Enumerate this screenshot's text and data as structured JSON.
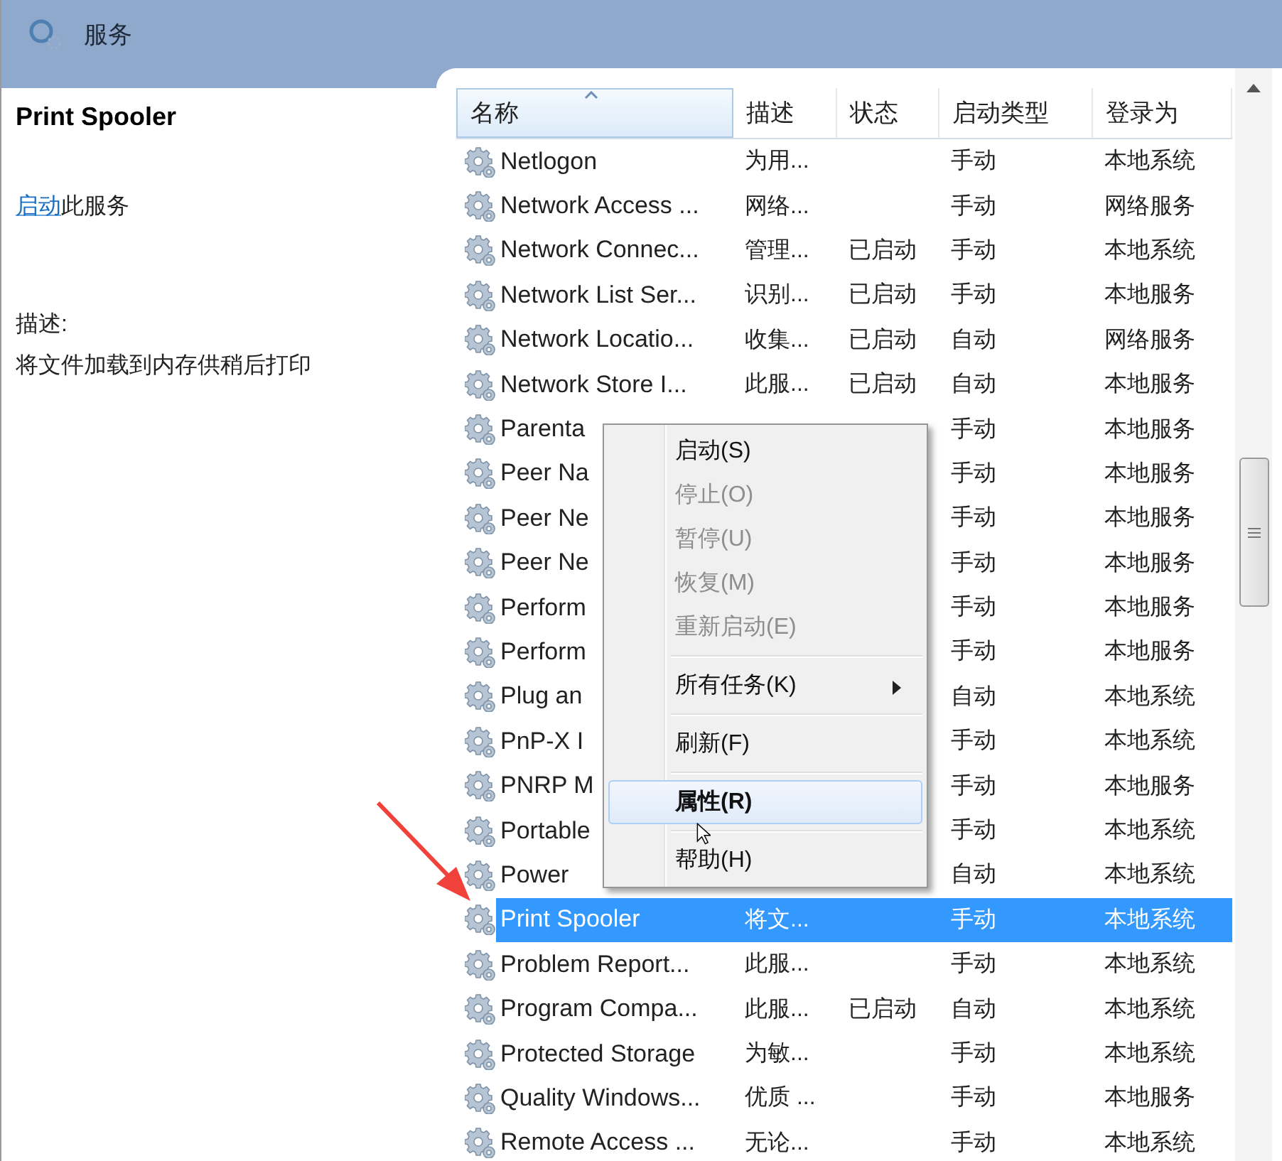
{
  "window": {
    "title": "服务"
  },
  "detail": {
    "title": "Print Spooler",
    "action_link": "启动",
    "action_text": "此服务",
    "description_label": "描述:",
    "description": "将文件加载到内存供稍后打印"
  },
  "table": {
    "columns": [
      {
        "label": "名称",
        "sorted": true
      },
      {
        "label": "描述",
        "sorted": false
      },
      {
        "label": "状态",
        "sorted": false
      },
      {
        "label": "启动类型",
        "sorted": false
      },
      {
        "label": "登录为",
        "sorted": false
      }
    ],
    "rows": [
      {
        "name": "Netlogon",
        "description": "为用...",
        "status": "",
        "startup": "手动",
        "logon": "本地系统",
        "selected": false
      },
      {
        "name": "Network Access ...",
        "description": "网络...",
        "status": "",
        "startup": "手动",
        "logon": "网络服务",
        "selected": false
      },
      {
        "name": "Network Connec...",
        "description": "管理...",
        "status": "已启动",
        "startup": "手动",
        "logon": "本地系统",
        "selected": false
      },
      {
        "name": "Network List Ser...",
        "description": "识别...",
        "status": "已启动",
        "startup": "手动",
        "logon": "本地服务",
        "selected": false
      },
      {
        "name": "Network Locatio...",
        "description": "收集...",
        "status": "已启动",
        "startup": "自动",
        "logon": "网络服务",
        "selected": false
      },
      {
        "name": "Network Store I...",
        "description": "此服...",
        "status": "已启动",
        "startup": "自动",
        "logon": "本地服务",
        "selected": false
      },
      {
        "name": "Parenta",
        "description": "",
        "status": "",
        "startup": "手动",
        "logon": "本地服务",
        "selected": false
      },
      {
        "name": "Peer Na",
        "description": "",
        "status": "",
        "startup": "手动",
        "logon": "本地服务",
        "selected": false
      },
      {
        "name": "Peer Ne",
        "description": "",
        "status": "",
        "startup": "手动",
        "logon": "本地服务",
        "selected": false
      },
      {
        "name": "Peer Ne",
        "description": "",
        "status": "",
        "startup": "手动",
        "logon": "本地服务",
        "selected": false
      },
      {
        "name": "Perform",
        "description": "",
        "status": "",
        "startup": "手动",
        "logon": "本地服务",
        "selected": false
      },
      {
        "name": "Perform",
        "description": "",
        "status": "",
        "startup": "手动",
        "logon": "本地服务",
        "selected": false
      },
      {
        "name": "Plug an",
        "description": "",
        "status": "",
        "startup": "自动",
        "logon": "本地系统",
        "selected": false
      },
      {
        "name": "PnP-X I",
        "description": "",
        "status": "",
        "startup": "手动",
        "logon": "本地系统",
        "selected": false
      },
      {
        "name": "PNRP M",
        "description": "",
        "status": "",
        "startup": "手动",
        "logon": "本地服务",
        "selected": false
      },
      {
        "name": "Portable",
        "description": "",
        "status": "",
        "startup": "手动",
        "logon": "本地系统",
        "selected": false
      },
      {
        "name": "Power",
        "description": "",
        "status": "",
        "startup": "自动",
        "logon": "本地系统",
        "selected": false
      },
      {
        "name": "Print Spooler",
        "description": "将文...",
        "status": "",
        "startup": "手动",
        "logon": "本地系统",
        "selected": true
      },
      {
        "name": "Problem Report...",
        "description": "此服...",
        "status": "",
        "startup": "手动",
        "logon": "本地系统",
        "selected": false
      },
      {
        "name": "Program Compa...",
        "description": "此服...",
        "status": "已启动",
        "startup": "自动",
        "logon": "本地系统",
        "selected": false
      },
      {
        "name": "Protected Storage",
        "description": "为敏...",
        "status": "",
        "startup": "手动",
        "logon": "本地系统",
        "selected": false
      },
      {
        "name": "Quality Windows...",
        "description": "优质 ...",
        "status": "",
        "startup": "手动",
        "logon": "本地服务",
        "selected": false
      },
      {
        "name": "Remote Access ...",
        "description": "无论...",
        "status": "",
        "startup": "手动",
        "logon": "本地系统",
        "selected": false
      }
    ]
  },
  "context_menu": {
    "items": [
      {
        "kind": "item",
        "label": "启动(S)",
        "disabled": false,
        "selected": false,
        "default": false,
        "submenu": false
      },
      {
        "kind": "item",
        "label": "停止(O)",
        "disabled": true,
        "selected": false,
        "default": false,
        "submenu": false
      },
      {
        "kind": "item",
        "label": "暂停(U)",
        "disabled": true,
        "selected": false,
        "default": false,
        "submenu": false
      },
      {
        "kind": "item",
        "label": "恢复(M)",
        "disabled": true,
        "selected": false,
        "default": false,
        "submenu": false
      },
      {
        "kind": "item",
        "label": "重新启动(E)",
        "disabled": true,
        "selected": false,
        "default": false,
        "submenu": false
      },
      {
        "kind": "separator"
      },
      {
        "kind": "item",
        "label": "所有任务(K)",
        "disabled": false,
        "selected": false,
        "default": false,
        "submenu": true
      },
      {
        "kind": "separator"
      },
      {
        "kind": "item",
        "label": "刷新(F)",
        "disabled": false,
        "selected": false,
        "default": false,
        "submenu": false
      },
      {
        "kind": "separator"
      },
      {
        "kind": "item",
        "label": "属性(R)",
        "disabled": false,
        "selected": true,
        "default": true,
        "submenu": false
      },
      {
        "kind": "separator"
      },
      {
        "kind": "item",
        "label": "帮助(H)",
        "disabled": false,
        "selected": false,
        "default": false,
        "submenu": false
      }
    ]
  }
}
